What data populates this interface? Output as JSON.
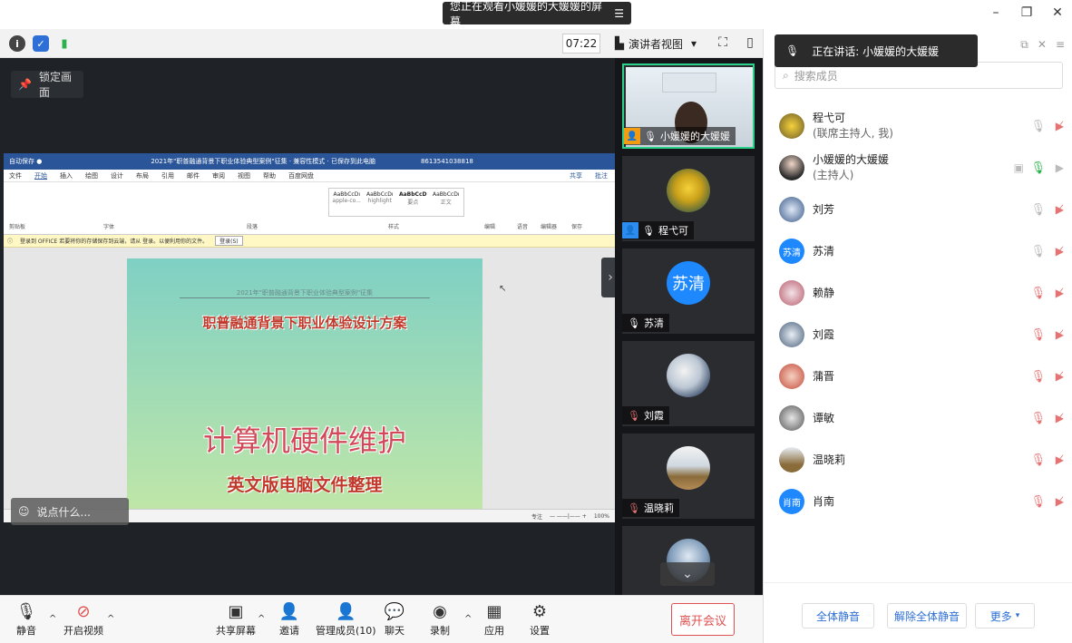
{
  "banner": {
    "text": "您正在观看小媛媛的大媛媛的屏幕",
    "menu_icon": "menu-icon"
  },
  "window": {
    "minimize": "–",
    "restore": "❐",
    "close": "✕"
  },
  "toolbar": {
    "time": "07:22",
    "view_label": "演讲者视图",
    "view_caret": "▾"
  },
  "stage": {
    "lock_label": "锁定画面",
    "say_placeholder": "说点什么...",
    "doc": {
      "header": "2021年\"职普融通背景下职业体验典型案例\"征集",
      "title": "职普融通背景下职业体验设计方案",
      "big": "计算机硬件维护",
      "sub": "英文版电脑文件整理",
      "word_title": "2021年\"职普融通背景下职业体验典型案例\"征集 · 兼容性模式 · 已保存到此电脑",
      "word_account": "8613541038818",
      "menu": [
        "文件",
        "开始",
        "插入",
        "绘图",
        "设计",
        "布局",
        "引用",
        "邮件",
        "审阅",
        "视图",
        "帮助",
        "百度网盘"
      ],
      "share_btn": "共享",
      "comment_btn": "批注",
      "styles": [
        "AaBbCcDı",
        "AaBbCcDı",
        "AaBbCcD",
        "AaBbCcDı"
      ],
      "style_names": [
        "apple-co...",
        "highlight",
        "要点",
        "正文"
      ],
      "ribbon_groups": [
        "剪贴板",
        "字体",
        "段落",
        "样式",
        "编辑",
        "语音",
        "编辑器",
        "保存"
      ],
      "office_notice": "登录到 OFFICE  若要将你的存储保存到云端，请从 登录。以便利用你的文件。",
      "notice_btn": "登录(S)",
      "status_right": "专注",
      "zoom": "100%"
    }
  },
  "thumbs": [
    {
      "name": "小媛媛的大媛媛",
      "type": "video",
      "active": true
    },
    {
      "name": "程弋可",
      "type": "photo"
    },
    {
      "name": "苏清",
      "type": "initials",
      "initials": "苏清"
    },
    {
      "name": "刘霞",
      "type": "photo"
    },
    {
      "name": "温晓莉",
      "type": "photo"
    },
    {
      "name": "",
      "type": "photo"
    }
  ],
  "bottom": {
    "mute": "静音",
    "video": "开启视频",
    "share": "共享屏幕",
    "invite": "邀请",
    "manage": "管理成员(10)",
    "chat": "聊天",
    "record": "录制",
    "apps": "应用",
    "settings": "设置",
    "leave": "离开会议"
  },
  "panel": {
    "speaking": "正在讲话: 小媛媛的大媛媛",
    "search_placeholder": "搜索成员",
    "members": [
      {
        "name": "程弋可",
        "sub": "(联席主持人, 我)",
        "mic": "on",
        "cam": "off",
        "avatar": "photo-yellow"
      },
      {
        "name": "小媛媛的大媛媛",
        "sub": "(主持人)",
        "mic": "active",
        "cam": "on",
        "avatar": "photo-woman"
      },
      {
        "name": "刘芳",
        "sub": "",
        "mic": "on",
        "cam": "off",
        "avatar": "photo-blue"
      },
      {
        "name": "苏清",
        "sub": "",
        "mic": "on",
        "cam": "off",
        "avatar": "initials",
        "initials": "苏清"
      },
      {
        "name": "赖静",
        "sub": "",
        "mic": "muted",
        "cam": "off",
        "avatar": "photo-pink"
      },
      {
        "name": "刘霞",
        "sub": "",
        "mic": "muted",
        "cam": "off",
        "avatar": "photo-kids"
      },
      {
        "name": "蒲晋",
        "sub": "",
        "mic": "muted",
        "cam": "off",
        "avatar": "photo-red"
      },
      {
        "name": "谭敏",
        "sub": "",
        "mic": "muted",
        "cam": "off",
        "avatar": "photo-gray"
      },
      {
        "name": "温晓莉",
        "sub": "",
        "mic": "muted",
        "cam": "off",
        "avatar": "photo-beach"
      },
      {
        "name": "肖南",
        "sub": "",
        "mic": "muted",
        "cam": "off",
        "avatar": "initials",
        "initials": "肖南"
      }
    ],
    "mute_all": "全体静音",
    "unmute_all": "解除全体静音",
    "more": "更多"
  },
  "colors": {
    "accent": "#2d6fd6",
    "active_border": "#2bd18a",
    "leave": "#e05050",
    "word_blue": "#2a5598"
  }
}
